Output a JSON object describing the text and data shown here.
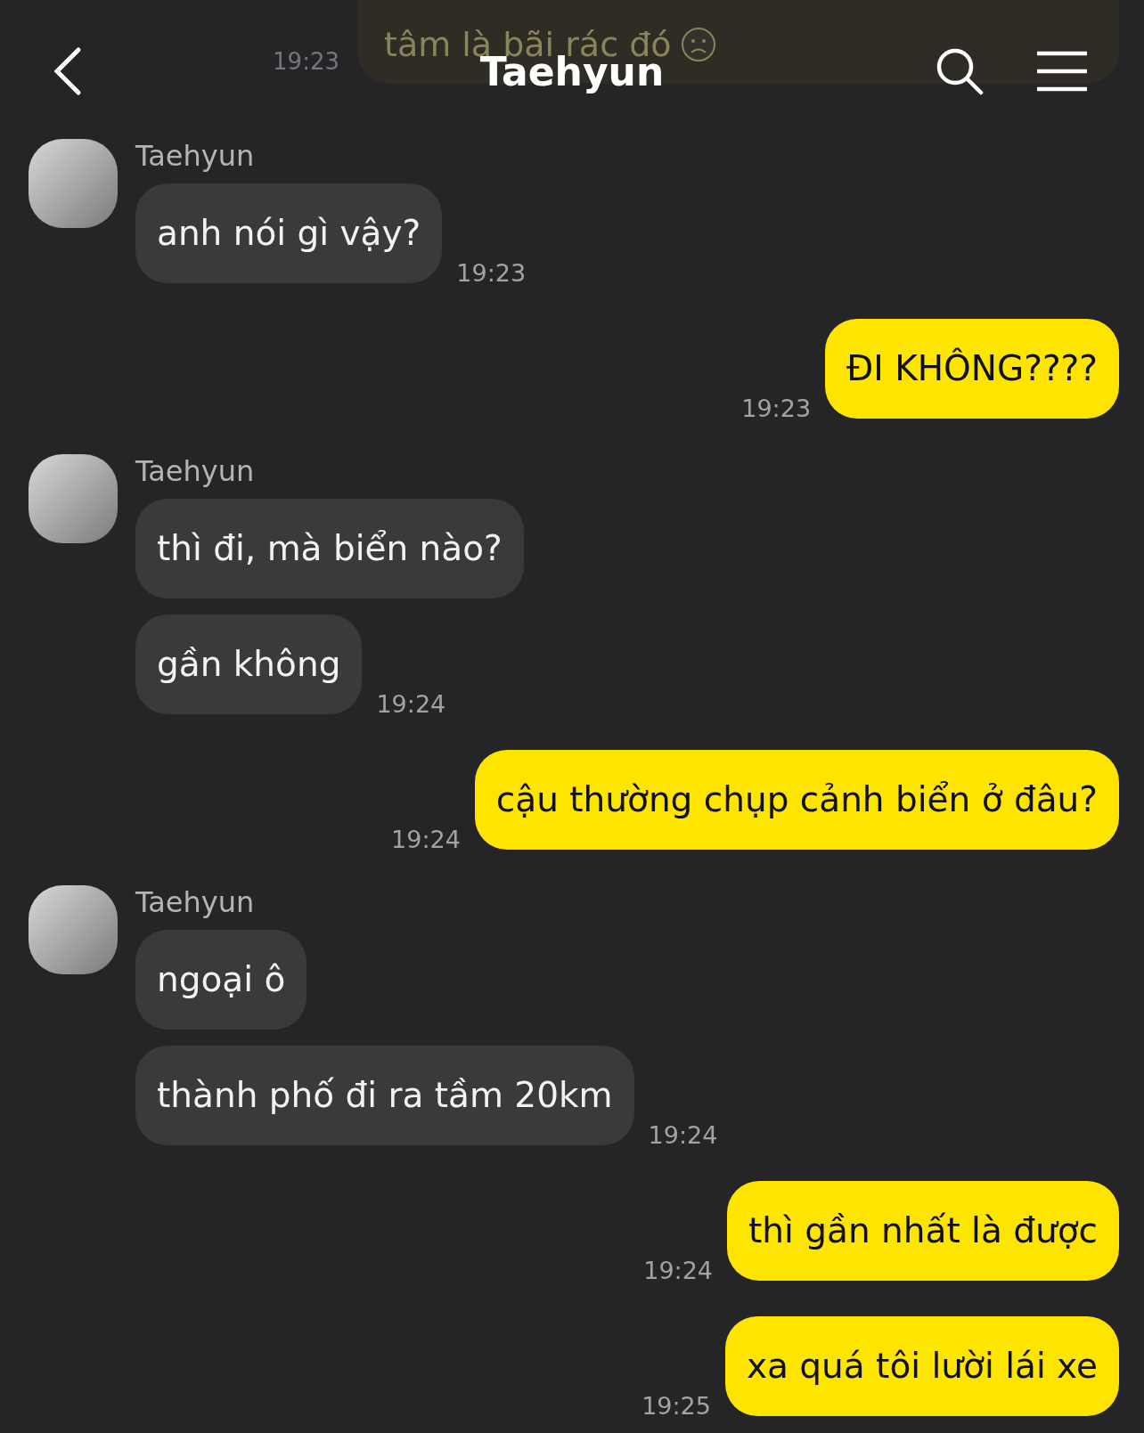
{
  "header": {
    "title": "Taehyun"
  },
  "behind_header": {
    "text": "tâm là bãi rác đó",
    "time": "19:23"
  },
  "messages": [
    {
      "kind": "received",
      "sender": "Taehyun",
      "bubbles": [
        "anh nói gì vậy?"
      ],
      "time": "19:23"
    },
    {
      "kind": "sent",
      "bubbles": [
        "ĐI KHÔNG????"
      ],
      "time": "19:23"
    },
    {
      "kind": "received",
      "sender": "Taehyun",
      "bubbles": [
        "thì đi, mà biển nào?",
        "gần không"
      ],
      "time": "19:24"
    },
    {
      "kind": "sent",
      "bubbles": [
        "cậu thường chụp cảnh biển ở đâu?"
      ],
      "time": "19:24"
    },
    {
      "kind": "received",
      "sender": "Taehyun",
      "bubbles": [
        "ngoại ô",
        "thành phố đi ra tầm 20km"
      ],
      "time": "19:24"
    },
    {
      "kind": "sent",
      "bubbles": [
        "thì gần nhất là được"
      ],
      "time": "19:24"
    },
    {
      "kind": "sent",
      "bubbles": [
        "xa quá tôi lười lái xe"
      ],
      "time": "19:25"
    }
  ]
}
